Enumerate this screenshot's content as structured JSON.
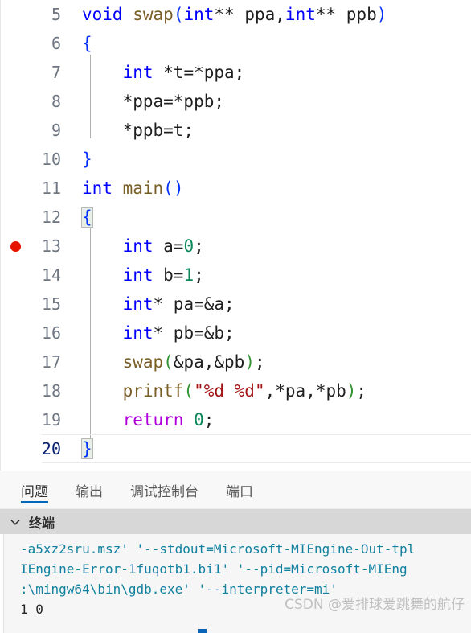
{
  "editor": {
    "first_visible_line": 5,
    "breakpoint_line": 13,
    "active_line": 20,
    "lines": [
      {
        "num": "5",
        "text": "void swap(int** ppa,int** ppb)"
      },
      {
        "num": "6",
        "text": "{"
      },
      {
        "num": "7",
        "text": "    int *t=*ppa;"
      },
      {
        "num": "8",
        "text": "    *ppa=*ppb;"
      },
      {
        "num": "9",
        "text": "    *ppb=t;"
      },
      {
        "num": "10",
        "text": "}"
      },
      {
        "num": "11",
        "text": "int main()"
      },
      {
        "num": "12",
        "text": "{"
      },
      {
        "num": "13",
        "text": "    int a=0;"
      },
      {
        "num": "14",
        "text": "    int b=1;"
      },
      {
        "num": "15",
        "text": "    int* pa=&a;"
      },
      {
        "num": "16",
        "text": "    int* pb=&b;"
      },
      {
        "num": "17",
        "text": "    swap(&pa,&pb);"
      },
      {
        "num": "18",
        "text": "    printf(\"%d %d\",*pa,*pb);"
      },
      {
        "num": "19",
        "text": "    return 0;"
      },
      {
        "num": "20",
        "text": "}"
      }
    ],
    "tokens": {
      "l5": [
        [
          "kw",
          "void"
        ],
        [
          "plain",
          " "
        ],
        [
          "fn",
          "swap"
        ],
        [
          "p0",
          "("
        ],
        [
          "kw",
          "int"
        ],
        [
          "plain",
          "** ppa,"
        ],
        [
          "kw",
          "int"
        ],
        [
          "plain",
          "** ppb"
        ],
        [
          "p0",
          ")"
        ]
      ],
      "l6": [
        [
          "p0",
          "{"
        ]
      ],
      "l7": [
        [
          "plain",
          "    "
        ],
        [
          "kw",
          "int"
        ],
        [
          "plain",
          " *t=*ppa;"
        ]
      ],
      "l8": [
        [
          "plain",
          "    *ppa=*ppb;"
        ]
      ],
      "l9": [
        [
          "plain",
          "    *ppb=t;"
        ]
      ],
      "l10": [
        [
          "p0",
          "}"
        ]
      ],
      "l11": [
        [
          "kw",
          "int"
        ],
        [
          "plain",
          " "
        ],
        [
          "fn",
          "main"
        ],
        [
          "p0",
          "()"
        ]
      ],
      "l12": [
        [
          "p0",
          "{"
        ]
      ],
      "l13": [
        [
          "plain",
          "    "
        ],
        [
          "kw",
          "int"
        ],
        [
          "plain",
          " a="
        ],
        [
          "num",
          "0"
        ],
        [
          "plain",
          ";"
        ]
      ],
      "l14": [
        [
          "plain",
          "    "
        ],
        [
          "kw",
          "int"
        ],
        [
          "plain",
          " b="
        ],
        [
          "num",
          "1"
        ],
        [
          "plain",
          ";"
        ]
      ],
      "l15": [
        [
          "plain",
          "    "
        ],
        [
          "kw",
          "int"
        ],
        [
          "plain",
          "* pa=&a;"
        ]
      ],
      "l16": [
        [
          "plain",
          "    "
        ],
        [
          "kw",
          "int"
        ],
        [
          "plain",
          "* pb=&b;"
        ]
      ],
      "l17": [
        [
          "plain",
          "    "
        ],
        [
          "fn",
          "swap"
        ],
        [
          "p1",
          "("
        ],
        [
          "plain",
          "&pa,&pb"
        ],
        [
          "p1",
          ")"
        ],
        [
          "plain",
          ";"
        ]
      ],
      "l18": [
        [
          "plain",
          "    "
        ],
        [
          "fn",
          "printf"
        ],
        [
          "p1",
          "("
        ],
        [
          "str",
          "\"%d %d\""
        ],
        [
          "plain",
          ",*pa,*pb"
        ],
        [
          "p1",
          ")"
        ],
        [
          "plain",
          ";"
        ]
      ],
      "l19": [
        [
          "plain",
          "    "
        ],
        [
          "ctl",
          "return"
        ],
        [
          "plain",
          " "
        ],
        [
          "num",
          "0"
        ],
        [
          "plain",
          ";"
        ]
      ],
      "l20": [
        [
          "p0",
          "}"
        ]
      ]
    }
  },
  "panel": {
    "tabs": [
      {
        "label": "问题",
        "active": true
      },
      {
        "label": "输出",
        "active": false
      },
      {
        "label": "调试控制台",
        "active": false
      },
      {
        "label": "端口",
        "active": false
      }
    ],
    "section": {
      "title": "终端",
      "chevron_icon": "chevron-down-icon",
      "expanded": true
    },
    "terminal": {
      "lines": [
        {
          "text": "-a5xz2sru.msz' '--stdout=Microsoft-MIEngine-Out-tpl",
          "kind": "log"
        },
        {
          "text": "IEngine-Error-1fuqotb1.bi1' '--pid=Microsoft-MIEng",
          "kind": "log"
        },
        {
          "text": ":\\mingw64\\bin\\gdb.exe' '--interpreter=mi'",
          "kind": "log"
        },
        {
          "text": "1 0",
          "kind": "output"
        }
      ]
    }
  },
  "watermark": {
    "text": "CSDN @爱排球爱跳舞的航仔"
  },
  "colors": {
    "breakpoint_red": "#e51400",
    "keyword_blue": "#0000ff",
    "control_purple": "#af00db",
    "function_brown": "#795e26",
    "number_green": "#098658",
    "string_red": "#a31515",
    "terminal_teal": "#11819f",
    "active_tab_underline": "#0066b8",
    "active_line_number": "#0b216f",
    "section_header_bg": "#d7d7d7"
  }
}
